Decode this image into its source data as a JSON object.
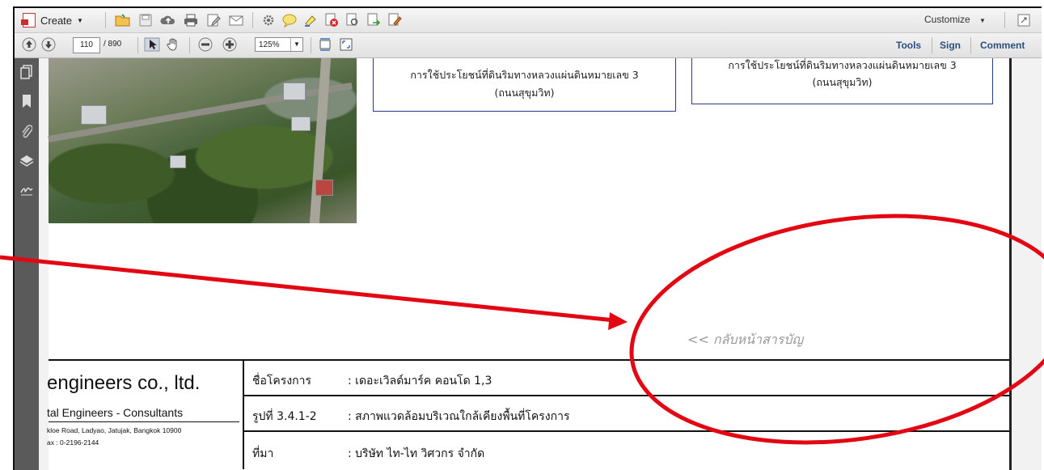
{
  "toolbar": {
    "create_label": "Create",
    "customize_label": "Customize",
    "current_page": "110",
    "total_pages": "/ 890",
    "zoom_level": "125%",
    "tools_label": "Tools",
    "sign_label": "Sign",
    "comment_label": "Comment"
  },
  "document": {
    "box_left_line1": "การใช้ประโยชน์ที่ดินริมทางหลวงแผ่นดินหมายเลข 3",
    "box_left_line2": "(ถนนสุขุมวิท)",
    "box_right_line1": "การใช้ประโยชน์ที่ดินริมทางหลวงแผ่นดินหมายเลข 3",
    "box_right_line2": "(ถนนสุขุมวิท)",
    "back_link": "<< กลับหน้าสารบัญ",
    "company_name": "engineers co., ltd.",
    "company_sub": "tal Engineers - Consultants",
    "address": "kloe Road, Ladyao, Jatujak, Bangkok 10900",
    "fax": "ax : 0-2196-2144",
    "rows": [
      {
        "label": "ชื่อโครงการ",
        "value": ": เดอะเวิลด์มาร์ค คอนโด 1,3"
      },
      {
        "label": "รูปที่ 3.4.1-2",
        "value": ": สภาพแวดล้อมบริเวณใกล้เคียงพื้นที่โครงการ"
      },
      {
        "label": "ที่มา",
        "value": ": บริษัท ไท-ไท วิศวกร จำกัด"
      }
    ]
  },
  "annotation": {
    "color": "#e30613"
  }
}
